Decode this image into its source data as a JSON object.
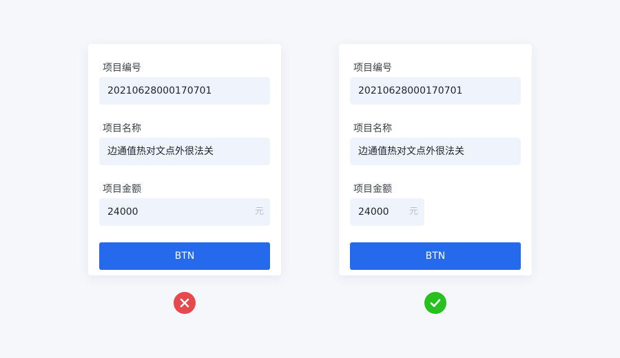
{
  "left_form": {
    "project_no_label": "项目编号",
    "project_no_value": "20210628000170701",
    "project_name_label": "项目名称",
    "project_name_value": "边通值热对文点外很法关",
    "amount_label": "项目金额",
    "amount_value": "24000",
    "amount_unit": "元",
    "button_label": "BTN"
  },
  "right_form": {
    "project_no_label": "项目编号",
    "project_no_value": "20210628000170701",
    "project_name_label": "项目名称",
    "project_name_value": "边通值热对文点外很法关",
    "amount_label": "项目金额",
    "amount_value": "24000",
    "amount_unit": "元",
    "button_label": "BTN"
  },
  "verdicts": {
    "left_icon": "close-icon",
    "left_color": "#e5484d",
    "right_icon": "check-icon",
    "right_color": "#27c01f"
  }
}
